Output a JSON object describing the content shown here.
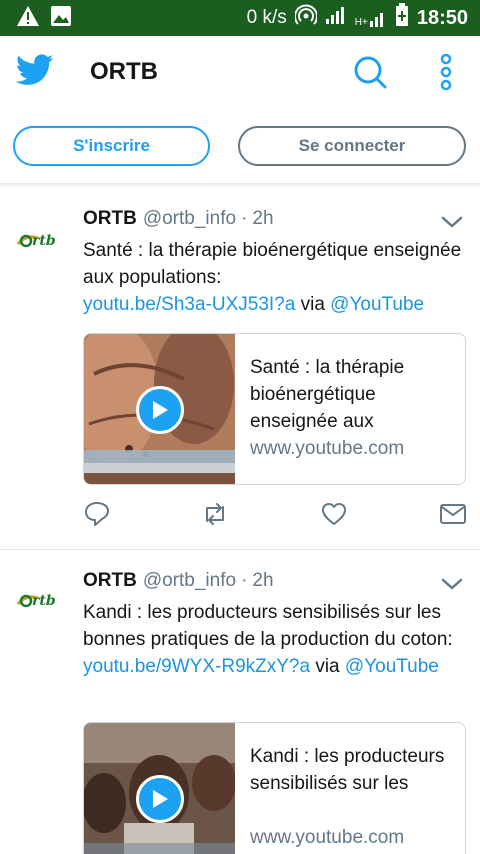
{
  "statusbar": {
    "speed": "0 k/s",
    "time": "18:50",
    "network_label": "H+"
  },
  "header": {
    "title": "ORTB",
    "accent": "#1da1f2"
  },
  "auth": {
    "signup_label": "S'inscrire",
    "login_label": "Se connecter"
  },
  "tweets": [
    {
      "name": "ORTB",
      "handle": "@ortb_info",
      "sep": "·",
      "time": "2h",
      "text_prefix": "Santé : la thérapie bioénergétique enseignée aux populations:",
      "link": "youtu.be/Sh3a-UXJ53I?a",
      "via": "via",
      "mention": "@YouTube",
      "card_title": "Santé : la thérapie bioénergétique enseignée aux",
      "card_domain": "www.youtube.com"
    },
    {
      "name": "ORTB",
      "handle": "@ortb_info",
      "sep": "·",
      "time": "2h",
      "text_prefix": "Kandi : les producteurs sensibilisés sur les bonnes pratiques de la production du coton:",
      "link": "youtu.be/9WYX-R9kZxY?a",
      "via": "via",
      "mention": "@YouTube",
      "card_title": "Kandi : les producteurs sensibilisés sur les",
      "card_domain": "www.youtube.com"
    }
  ]
}
